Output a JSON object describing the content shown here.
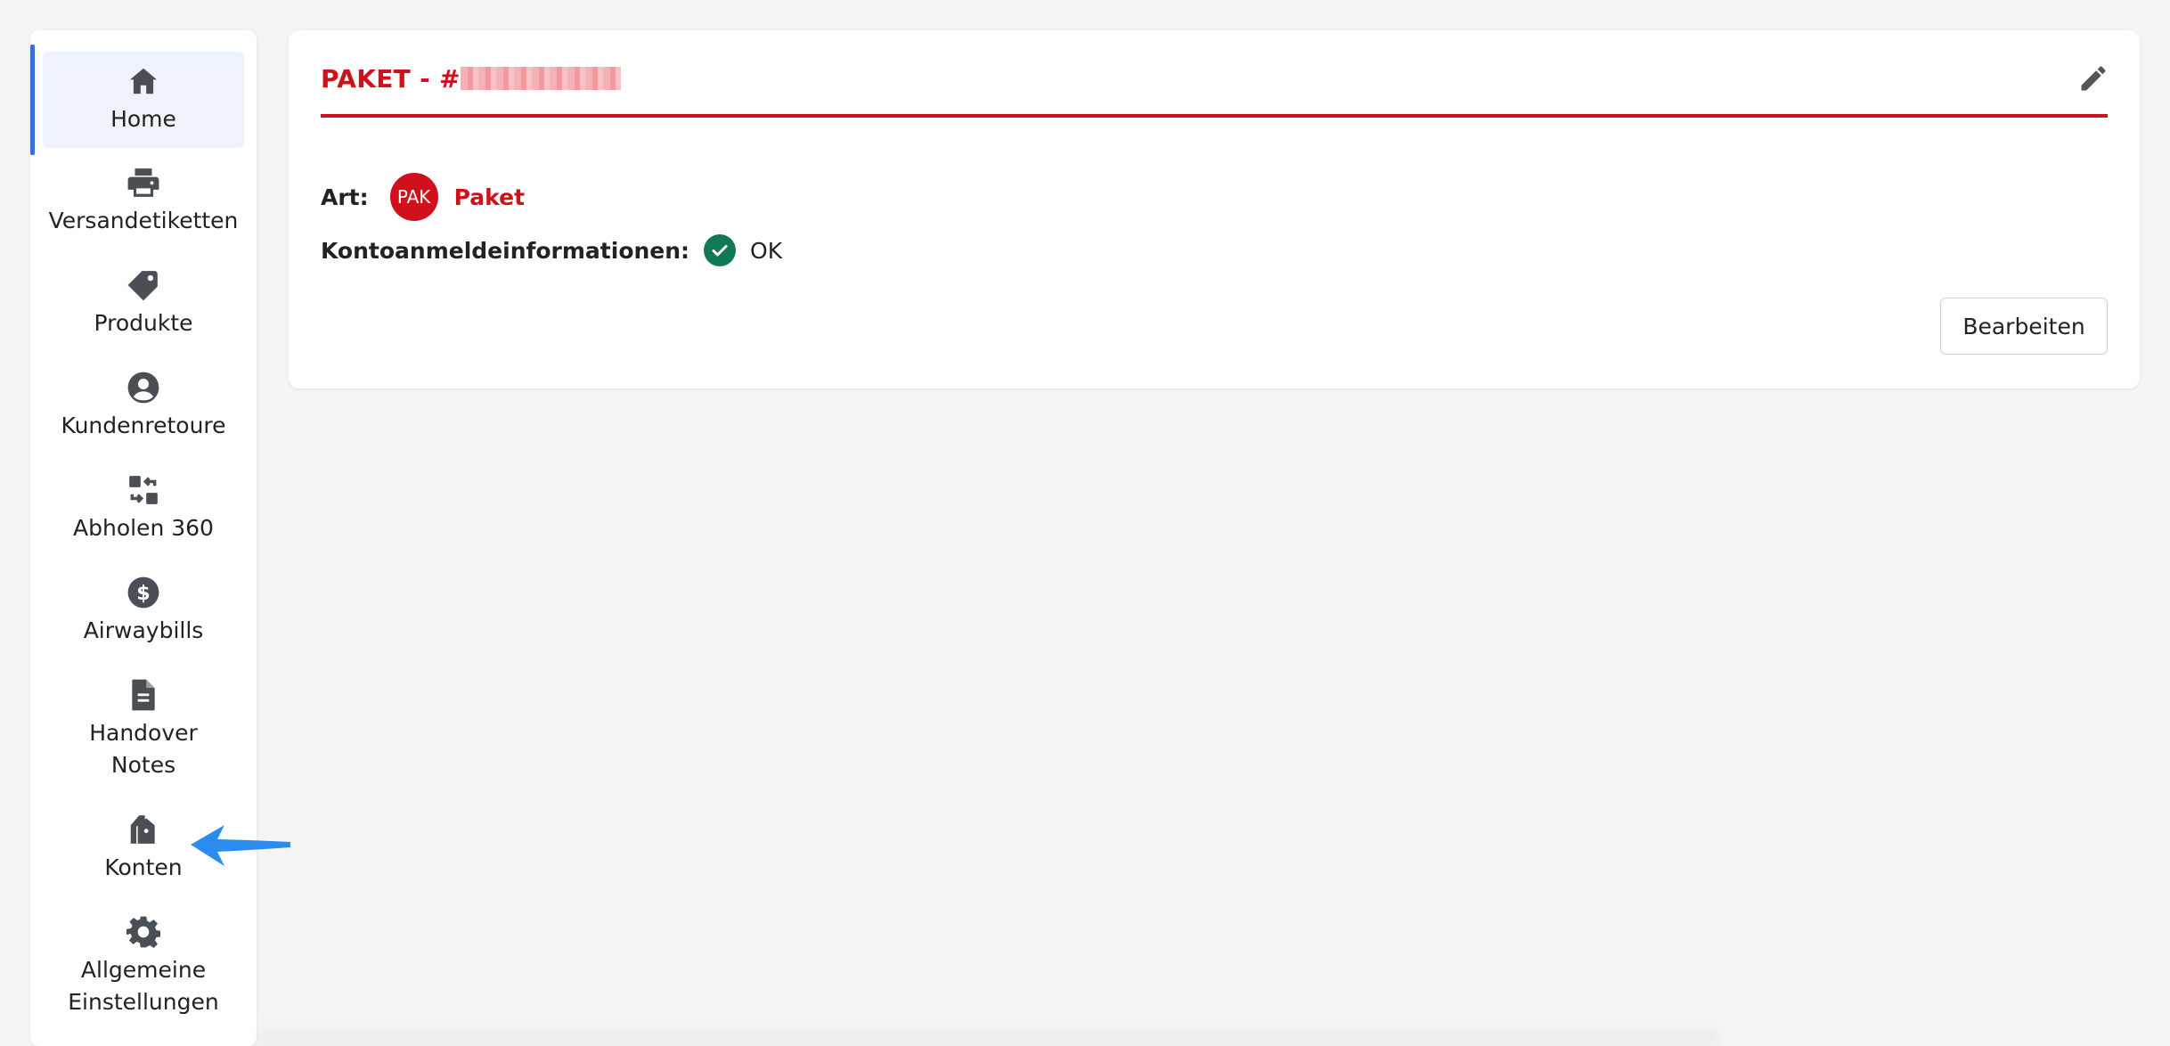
{
  "sidebar": {
    "items": [
      {
        "label": "Home",
        "icon": "home-icon",
        "active": true
      },
      {
        "label": "Versandetiketten",
        "icon": "printer-icon"
      },
      {
        "label": "Produkte",
        "icon": "tag-icon"
      },
      {
        "label": "Kundenretoure",
        "icon": "user-circle-icon"
      },
      {
        "label": "Abholen 360",
        "icon": "swap-icon"
      },
      {
        "label": "Airwaybills",
        "icon": "dollar-icon"
      },
      {
        "label": "Handover Notes",
        "icon": "document-icon"
      },
      {
        "label": "Konten",
        "icon": "tags-icon"
      },
      {
        "label": "Allgemeine Einstellungen",
        "icon": "gear-icon"
      }
    ]
  },
  "card": {
    "title_prefix": "PAKET - #",
    "type_label": "Art:",
    "type_badge": "PAK",
    "type_value": "Paket",
    "credentials_label": "Kontoanmeldeinformationen:",
    "credentials_status": "OK",
    "edit_button": "Bearbeiten"
  },
  "colors": {
    "accent": "#d0101b",
    "active_bar": "#3a6fd8",
    "ok": "#117a55",
    "arrow": "#2b8cf0"
  }
}
